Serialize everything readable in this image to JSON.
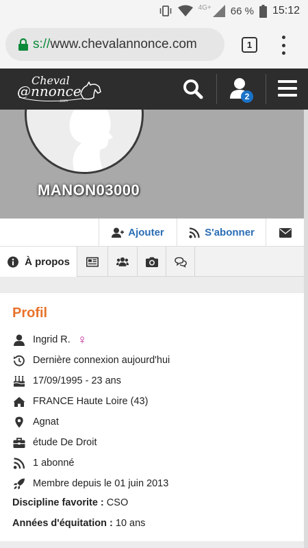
{
  "status_bar": {
    "network": "4G+",
    "battery": "66 %",
    "time": "15:12"
  },
  "browser": {
    "url_scheme": "s://",
    "url_host": "www.chevalannonce.com",
    "tab_count": "1"
  },
  "site": {
    "logo_text": "Cheval Annonce .com",
    "notification_count": "2"
  },
  "profile": {
    "username": "MANON03000"
  },
  "actions": {
    "add_label": "Ajouter",
    "subscribe_label": "S'abonner"
  },
  "tabs": {
    "about_label": "À propos"
  },
  "card": {
    "title": "Profil",
    "name": "Ingrid R.",
    "gender_symbol": "♀",
    "last_login": "Dernière connexion aujourd'hui",
    "birthdate": "17/09/1995 - 23 ans",
    "location": "FRANCE Haute Loire (43)",
    "city": "Agnat",
    "occupation": "étude De Droit",
    "subscribers": "1 abonné",
    "member_since": "Membre depuis le 01 juin 2013",
    "discipline_label": "Discipline favorite :",
    "discipline_value": "CSO",
    "years_label": "Années d'équitation :",
    "years_value": "10 ans"
  },
  "colors": {
    "accent_orange": "#e8722a",
    "link_blue": "#2a6db5",
    "header_dark": "#2d2d2d",
    "badge_blue": "#1a73c8",
    "female_pink": "#c2279a"
  }
}
